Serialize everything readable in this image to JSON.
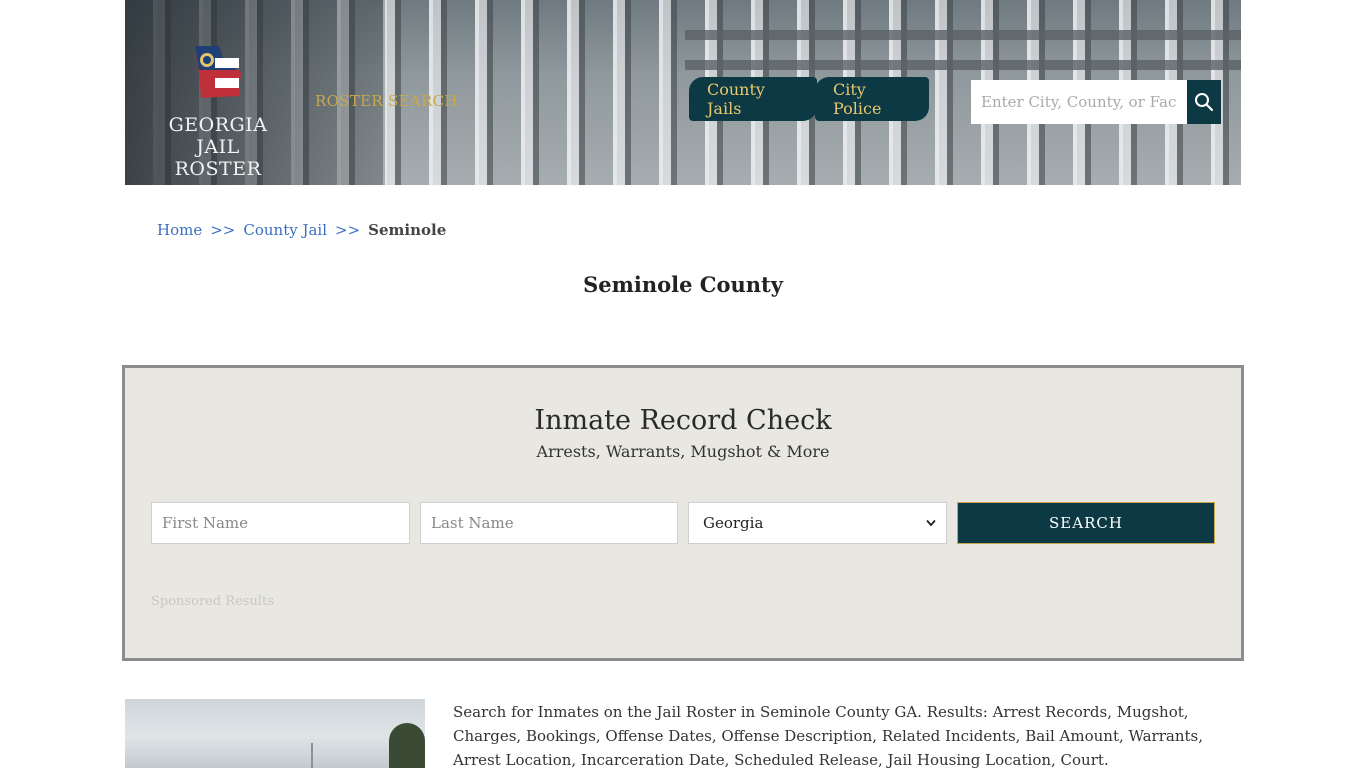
{
  "header": {
    "logo_line1": "GEORGIA",
    "logo_line2": "JAIL ROSTER",
    "roster_search": "ROSTER SEARCH",
    "nav": [
      {
        "label": "County Jails"
      },
      {
        "label": "City Police"
      }
    ],
    "search_placeholder": "Enter City, County, or Facility"
  },
  "breadcrumb": {
    "home": "Home",
    "sep": ">>",
    "county_jail": "County Jail",
    "current": "Seminole"
  },
  "page_title": "Seminole County",
  "record_check": {
    "title": "Inmate Record Check",
    "subtitle": "Arrests, Warrants, Mugshot & More",
    "first_name_placeholder": "First Name",
    "last_name_placeholder": "Last Name",
    "state_selected": "Georgia",
    "search_label": "SEARCH",
    "sponsored": "Sponsored Results"
  },
  "description": "Search for Inmates on the Jail Roster in Seminole County GA. Results: Arrest Records, Mugshot, Charges, Bookings, Offense Dates, Offense Description, Related Incidents, Bail Amount, Warrants, Arrest Location, Incarceration Date, Scheduled Release, Jail Housing Location, Court.",
  "colors": {
    "brand_dark": "#0c3943",
    "gold": "#c9a84a",
    "link": "#3a6fc4",
    "panel_bg": "#e8e7e2"
  }
}
